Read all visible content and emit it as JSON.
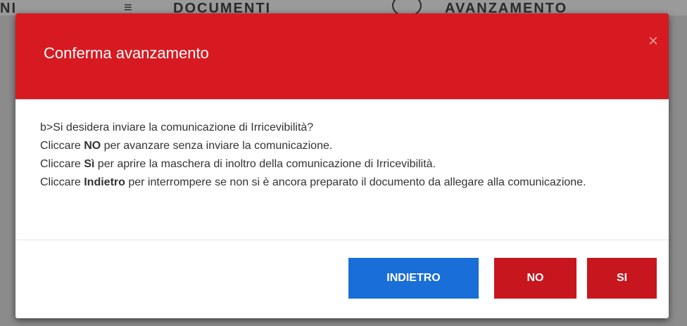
{
  "background": {
    "left_text": "NI",
    "docs_text": "DOCUMENTI",
    "advance_text": "AVANZAMENTO"
  },
  "modal": {
    "title": "Conferma avanzamento",
    "close_symbol": "×",
    "body": {
      "line1": "b>Si desidera inviare la comunicazione di Irricevibilità?",
      "line2": {
        "pre": "Cliccare ",
        "bold": "NO",
        "post": " per avanzare senza inviare la comunicazione."
      },
      "line3": {
        "pre": "Cliccare ",
        "bold": "Sì",
        "post": " per aprire la maschera di inoltro della comunicazione di Irricevibilità."
      },
      "line4": {
        "pre": "Cliccare ",
        "bold": "Indietro",
        "post": " per interrompere se non si è ancora preparato il documento da allegare alla comunicazione."
      }
    },
    "buttons": {
      "back_label": "INDIETRO",
      "no_label": "NO",
      "si_label": "SI"
    }
  },
  "colors": {
    "header_red": "#d71a21",
    "button_blue": "#1a6ed8",
    "button_red": "#c8161e"
  },
  "icons": {
    "close": "close-icon"
  }
}
